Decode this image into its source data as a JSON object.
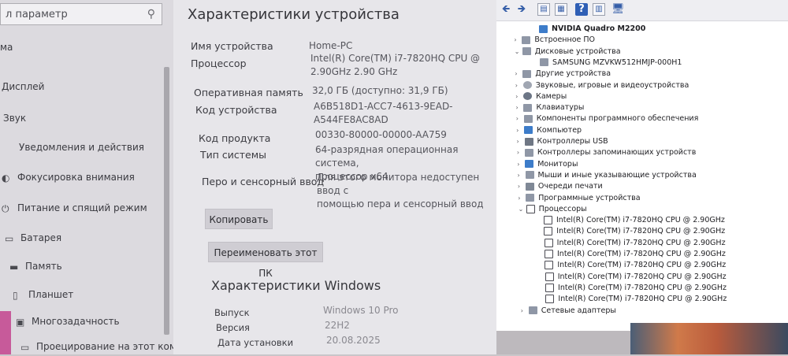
{
  "settings": {
    "search_placeholder": "л параметр",
    "nav": [
      {
        "label": "ма",
        "icon": "none"
      },
      {
        "label": "Дисплей",
        "icon": "display-icon"
      },
      {
        "label": "Звук",
        "icon": "sound-icon"
      },
      {
        "label": "Уведомления и действия",
        "icon": "notifications-icon"
      },
      {
        "label": "Фокусировка внимания",
        "icon": "focus-assist-icon"
      },
      {
        "label": "Питание и спящий режим",
        "icon": "power-icon"
      },
      {
        "label": "Батарея",
        "icon": "battery-icon"
      },
      {
        "label": "Память",
        "icon": "storage-icon"
      },
      {
        "label": "Планшет",
        "icon": "tablet-icon"
      },
      {
        "label": "Многозадачность",
        "icon": "multitasking-icon"
      },
      {
        "label": "Проецирование на этот компьютер",
        "icon": "projecting-icon"
      }
    ]
  },
  "about": {
    "title": "Характеристики устройства",
    "specs": [
      {
        "label": "Имя устройства",
        "value": [
          "Home-PC"
        ]
      },
      {
        "label": "Процессор",
        "value": [
          "Intel(R) Core(TM) i7-7820HQ CPU @",
          "2.90GHz   2.90 GHz"
        ]
      },
      {
        "label": "Оперативная память",
        "value": [
          "32,0 ГБ (доступно: 31,9 ГБ)"
        ]
      },
      {
        "label": "Код устройства",
        "value": [
          "A6B518D1-ACC7-4613-9EAD-",
          "A544FE8AC8AD"
        ]
      },
      {
        "label": "Код продукта",
        "value": [
          "00330-80000-00000-AA759"
        ]
      },
      {
        "label": "Тип системы",
        "value": [
          "64-разрядная операционная система,",
          "процессор x64"
        ]
      },
      {
        "label": "Перо и сенсорный ввод",
        "value": [
          "Для этого монитора недоступен ввод с",
          "помощью пера и сенсорный ввод"
        ]
      }
    ],
    "copy_button": "Копировать",
    "rename_button": "Переименовать этот ПК",
    "windows_title": "Характеристики Windows",
    "windows_specs": [
      {
        "label": "Выпуск",
        "value": "Windows 10 Pro"
      },
      {
        "label": "Версия",
        "value": "22H2"
      },
      {
        "label": "Дата установки",
        "value": "20.08.2025"
      }
    ]
  },
  "device_manager": {
    "toolbar_icons": [
      "back-arrow-icon",
      "forward-arrow-icon",
      "properties-icon",
      "view-icon",
      "help-icon",
      "update-driver-icon",
      "scan-hardware-icon"
    ],
    "tree": [
      {
        "label": "NVIDIA Quadro M2200",
        "level": 2,
        "arrow": "",
        "icon": "mon",
        "bold": true
      },
      {
        "label": "Встроенное ПО",
        "level": 1,
        "arrow": "›",
        "icon": "gen"
      },
      {
        "label": "Дисковые устройства",
        "level": 1,
        "arrow": "⌄",
        "icon": "gen"
      },
      {
        "label": "SAMSUNG MZVKW512HMJP-000H1",
        "level": 2,
        "arrow": "",
        "icon": "gen"
      },
      {
        "label": "Другие устройства",
        "level": 1,
        "arrow": "›",
        "icon": "gen"
      },
      {
        "label": "Звуковые, игровые и видеоустройства",
        "level": 1,
        "arrow": "›",
        "icon": "spk"
      },
      {
        "label": "Камеры",
        "level": 1,
        "arrow": "›",
        "icon": "cam"
      },
      {
        "label": "Клавиатуры",
        "level": 1,
        "arrow": "›",
        "icon": "gen"
      },
      {
        "label": "Компоненты программного обеспечения",
        "level": 1,
        "arrow": "›",
        "icon": "gen"
      },
      {
        "label": "Компьютер",
        "level": 1,
        "arrow": "›",
        "icon": "mon"
      },
      {
        "label": "Контроллеры USB",
        "level": 1,
        "arrow": "›",
        "icon": "usb"
      },
      {
        "label": "Контроллеры запоминающих устройств",
        "level": 1,
        "arrow": "›",
        "icon": "gen"
      },
      {
        "label": "Мониторы",
        "level": 1,
        "arrow": "›",
        "icon": "mon"
      },
      {
        "label": "Мыши и иные указывающие устройства",
        "level": 1,
        "arrow": "›",
        "icon": "gen"
      },
      {
        "label": "Очереди печати",
        "level": 1,
        "arrow": "›",
        "icon": "prn"
      },
      {
        "label": "Программные устройства",
        "level": 1,
        "arrow": "›",
        "icon": "gen"
      },
      {
        "label": "Процессоры",
        "level": 1,
        "arrow": "⌄",
        "icon": "cpu"
      },
      {
        "label": "Intel(R) Core(TM) i7-7820HQ CPU @ 2.90GHz",
        "level": 2,
        "arrow": "",
        "icon": "cpu"
      },
      {
        "label": "Intel(R) Core(TM) i7-7820HQ CPU @ 2.90GHz",
        "level": 2,
        "arrow": "",
        "icon": "cpu"
      },
      {
        "label": "Intel(R) Core(TM) i7-7820HQ CPU @ 2.90GHz",
        "level": 2,
        "arrow": "",
        "icon": "cpu"
      },
      {
        "label": "Intel(R) Core(TM) i7-7820HQ CPU @ 2.90GHz",
        "level": 2,
        "arrow": "",
        "icon": "cpu"
      },
      {
        "label": "Intel(R) Core(TM) i7-7820HQ CPU @ 2.90GHz",
        "level": 2,
        "arrow": "",
        "icon": "cpu"
      },
      {
        "label": "Intel(R) Core(TM) i7-7820HQ CPU @ 2.90GHz",
        "level": 2,
        "arrow": "",
        "icon": "cpu"
      },
      {
        "label": "Intel(R) Core(TM) i7-7820HQ CPU @ 2.90GHz",
        "level": 2,
        "arrow": "",
        "icon": "cpu"
      },
      {
        "label": "Intel(R) Core(TM) i7-7820HQ CPU @ 2.90GHz",
        "level": 2,
        "arrow": "",
        "icon": "cpu"
      },
      {
        "label": "Сетевые адаптеры",
        "level": 1,
        "arrow": "›",
        "icon": "gen"
      }
    ]
  }
}
